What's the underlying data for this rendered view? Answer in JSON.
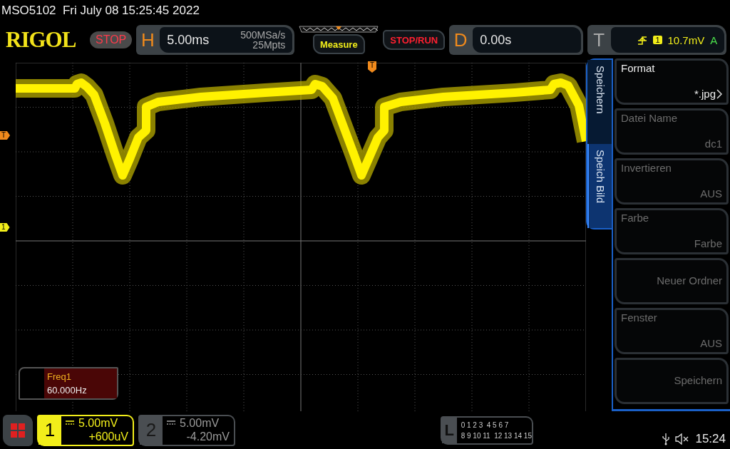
{
  "header": {
    "text": "MSO5102  Fri July 08 15:25:45 2022"
  },
  "toolbar": {
    "logo": "RIGOL",
    "run_state": "STOP",
    "horizontal": {
      "letter": "H",
      "timebase": "5.00ms",
      "sample_rate": "500MSa/s",
      "memory_depth": "25Mpts"
    },
    "measure_button": "Measure",
    "stop_run_button": "STOP/RUN",
    "delay": {
      "letter": "D",
      "value": "0.00s"
    },
    "trigger": {
      "letter": "T",
      "channel": "1",
      "level": "10.7mV",
      "mode": "A"
    }
  },
  "display": {
    "trigger_level_marker": "T",
    "trigger_position_marker": "T",
    "channel_marker": "1",
    "measurement": {
      "name": "Freq1",
      "value": "60.000Hz"
    }
  },
  "menu": {
    "tabs": [
      {
        "label": "Speichern",
        "selected": false
      },
      {
        "label": "Speich Bild",
        "selected": true
      }
    ],
    "items": [
      {
        "label": "Format",
        "value": "*.jpg",
        "disabled": false,
        "submenu": true
      },
      {
        "label": "Datei Name",
        "value": "dc1",
        "disabled": true,
        "submenu": false
      },
      {
        "label": "Invertieren",
        "value": "AUS",
        "disabled": true,
        "submenu": false
      },
      {
        "label": "Farbe",
        "value": "Farbe",
        "disabled": true,
        "submenu": false
      },
      {
        "value": "Neuer Ordner",
        "disabled": true,
        "submenu": false
      },
      {
        "label": "Fenster",
        "value": "AUS",
        "disabled": true,
        "submenu": false
      },
      {
        "value": "Speichern",
        "disabled": true,
        "submenu": false
      }
    ]
  },
  "channels": [
    {
      "number": "1",
      "scale": "5.00mV",
      "offset": "+600uV",
      "active": true
    },
    {
      "number": "2",
      "scale": "5.00mV",
      "offset": "-4.20mV",
      "active": false
    }
  ],
  "logic": {
    "letter": "L",
    "lines": [
      "0 1 2 3  4 5 6 7",
      "8 9 10 11  12 13 14 15"
    ]
  },
  "status": {
    "clock": "15:24"
  }
}
